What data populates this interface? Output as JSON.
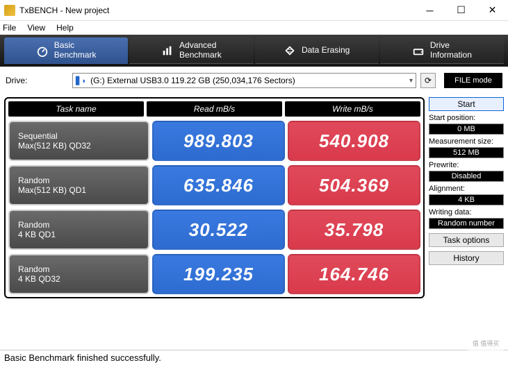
{
  "window": {
    "title": "TxBENCH - New project"
  },
  "menu": {
    "file": "File",
    "view": "View",
    "help": "Help"
  },
  "tabs": {
    "basic": "Basic\nBenchmark",
    "advanced": "Advanced\nBenchmark",
    "erase": "Data Erasing",
    "drive": "Drive\nInformation"
  },
  "drive": {
    "label": "Drive:",
    "value": "(G:) External USB3.0  119.22 GB (250,034,176 Sectors)",
    "mode": "FILE mode"
  },
  "headers": {
    "task": "Task name",
    "read": "Read mB/s",
    "write": "Write mB/s"
  },
  "rows": [
    {
      "name1": "Sequential",
      "name2": "Max(512 KB) QD32",
      "read": "989.803",
      "write": "540.908"
    },
    {
      "name1": "Random",
      "name2": "Max(512 KB) QD1",
      "read": "635.846",
      "write": "504.369"
    },
    {
      "name1": "Random",
      "name2": "4 KB QD1",
      "read": "30.522",
      "write": "35.798"
    },
    {
      "name1": "Random",
      "name2": "4 KB QD32",
      "read": "199.235",
      "write": "164.746"
    }
  ],
  "side": {
    "start": "Start",
    "startpos_lbl": "Start position:",
    "startpos": "0 MB",
    "msize_lbl": "Measurement size:",
    "msize": "512 MB",
    "prewrite_lbl": "Prewrite:",
    "prewrite": "Disabled",
    "align_lbl": "Alignment:",
    "align": "4 KB",
    "wdata_lbl": "Writing data:",
    "wdata": "Random number",
    "taskopt": "Task options",
    "history": "History"
  },
  "status": "Basic Benchmark finished successfully.",
  "watermark": "值 值得买"
}
